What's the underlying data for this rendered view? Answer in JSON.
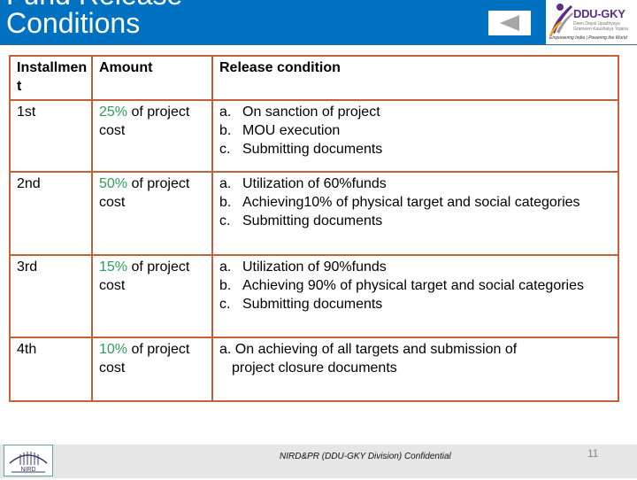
{
  "header": {
    "title_line1": "Fund Release",
    "title_line2": "Conditions",
    "back_button_icon": "triangle-left-icon",
    "logo": {
      "brand": "DDU-GKY",
      "subtitle": "Deen Dayal Upadhyaya Grameen Kaushalya Yojana",
      "tagline": "Empowering India | Powering the World"
    },
    "colors": {
      "banner": "#0070c0",
      "table_border": "#c0633a",
      "percent": "#2e9c5a"
    }
  },
  "table": {
    "headers": [
      "Installmen t",
      "Amount",
      "Release condition"
    ],
    "rows": [
      {
        "installment": "1st",
        "amount_pct": "25%",
        "amount_rest": " of project cost",
        "conditions": [
          {
            "marker": "a.",
            "text": "On sanction of project"
          },
          {
            "marker": "b.",
            "text": "MOU execution"
          },
          {
            "marker": "c.",
            "text": "Submitting documents"
          }
        ]
      },
      {
        "installment": "2nd",
        "amount_pct": "50%",
        "amount_rest": " of project cost",
        "conditions": [
          {
            "marker": "a.",
            "text": "Utilization of 60%funds"
          },
          {
            "marker": "b.",
            "text": "Achieving10% of physical target and social categories"
          },
          {
            "marker": "c.",
            "text": "Submitting documents"
          }
        ]
      },
      {
        "installment": "3rd",
        "amount_pct": "15%",
        "amount_rest": " of project cost",
        "conditions": [
          {
            "marker": "a.",
            "text": "Utilization of 90%funds"
          },
          {
            "marker": "b.",
            "text": "Achieving 90% of physical target and social categories"
          },
          {
            "marker": "c.",
            "text": "Submitting documents"
          }
        ]
      },
      {
        "installment": "4th",
        "amount_pct": "10%",
        "amount_rest": " of project cost",
        "condition_single": {
          "marker": "a.",
          "text": " On achieving of all targets and submission of",
          "continuation": "project closure documents"
        }
      }
    ]
  },
  "footer": {
    "logo_label": "NIRD",
    "confidential": "NIRD&PR (DDU-GKY Division) Confidential",
    "page_number": "11"
  }
}
